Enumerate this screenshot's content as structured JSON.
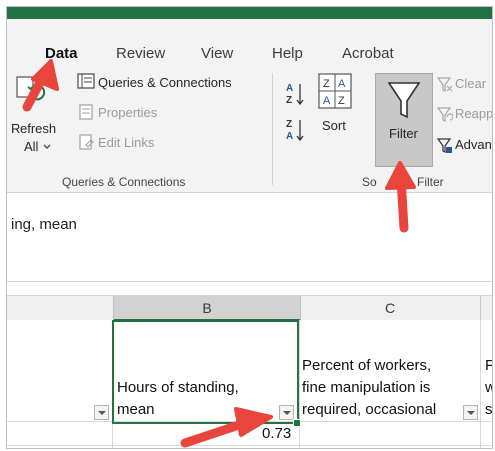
{
  "ribbon_tabs": {
    "data": "Data",
    "review": "Review",
    "view": "View",
    "help": "Help",
    "acrobat": "Acrobat"
  },
  "queries_group": {
    "refresh_top": "R",
    "refresh_line": "efresh",
    "all_label": "All",
    "queries_connections": "Queries & Connections",
    "properties": "Properties",
    "edit_links": "Edit Links",
    "group_label": "Queries & Connections"
  },
  "sort_group": {
    "sort_label": "Sort",
    "filter_label": "Filter",
    "clear_label": "Clear",
    "reapply_label": "Reapp",
    "advanced_label": "Advan",
    "group_label_left": "So",
    "group_label_right": "Filter"
  },
  "formula_bar": {
    "content": "ing, mean"
  },
  "column_headers": {
    "b": "B",
    "c": "C"
  },
  "cells": {
    "b_header_line1": "Hours of standing,",
    "b_header_line2": "mean",
    "c_header_line1": "Percent of workers,",
    "c_header_line2": "fine manipulation is",
    "c_header_line3": "required, occasional",
    "d_partial_line1": "P",
    "d_partial_line2": "w",
    "d_partial_line3": "sl",
    "b_value": "0.73"
  },
  "colors": {
    "excel_green": "#217346",
    "annotation_arrow": "#e8453c"
  }
}
